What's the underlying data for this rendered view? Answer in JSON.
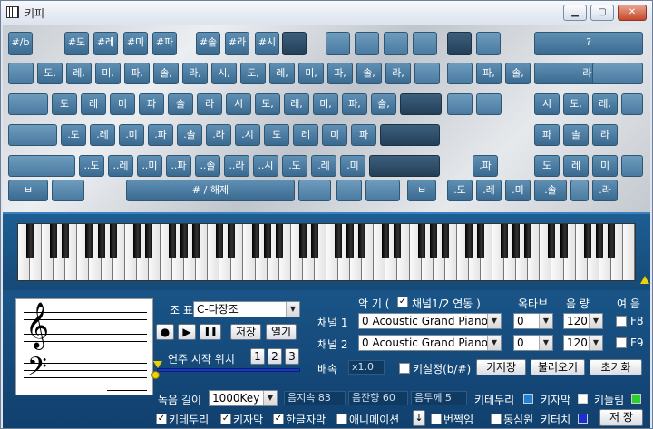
{
  "window": {
    "title": "키피",
    "min": "▁",
    "max": "▢",
    "close": "✕"
  },
  "keyboard": {
    "row1": [
      "#/b",
      "#도",
      "#레",
      "#미",
      "#파",
      "#솔",
      "#라",
      "#시",
      "",
      "",
      "",
      "",
      "",
      "",
      "",
      "?"
    ],
    "row2": [
      "",
      "도,",
      "레,",
      "미,",
      "파,",
      "솔,",
      "라,",
      "시,",
      "도,",
      "레,",
      "미,",
      "파,",
      "솔,",
      "라,",
      "",
      "",
      "파,",
      "솔,",
      "라,",
      ""
    ],
    "row3": [
      "",
      "도",
      "레",
      "미",
      "파",
      "솔",
      "라",
      "시",
      "도,",
      "레,",
      "미,",
      "파,",
      "솔,",
      "",
      "",
      "",
      "시",
      "도,",
      "레,",
      ""
    ],
    "row4": [
      "",
      ".도",
      ".레",
      ".미",
      ".파",
      ".솔",
      ".라",
      ".시",
      "도",
      "레",
      "미",
      "파",
      "",
      "파",
      "솔",
      "라"
    ],
    "row5": [
      "",
      "..도",
      "..레",
      "..미",
      "..파",
      "..솔",
      "..라",
      "..시",
      ".도",
      ".레",
      ".미",
      "",
      ".파",
      "도",
      "레",
      "미",
      ""
    ],
    "row6": [
      "ㅂ",
      "",
      "# / 해제",
      "",
      "",
      "",
      "ㅂ",
      ".도",
      ".레",
      ".미",
      ".솔",
      "",
      ".라"
    ]
  },
  "controls": {
    "key_label": "조 표",
    "key_value": "C-다장조",
    "transport": {
      "record": "●",
      "play": "▶",
      "pause": "❚❚",
      "save": "저장",
      "open": "열기"
    },
    "start_pos_label": "연주 시작 위치",
    "start_pos": [
      "1",
      "2",
      "3"
    ],
    "instrument_label": "악 기 (",
    "channel_both_label": "채널1/2 연동 )",
    "octave_label": "옥타브",
    "volume_label": "음 량",
    "sustain_label": "여 음",
    "ch1_label": "채널 1",
    "ch2_label": "채널 2",
    "ch1_instrument": "0 Acoustic Grand Piano",
    "ch2_instrument": "0 Acoustic Grand Piano",
    "ch1_octave": "0",
    "ch2_octave": "0",
    "ch1_volume": "120",
    "ch2_volume": "120",
    "f8": "F8",
    "f9": "F9",
    "speed_label": "배속",
    "speed_value": "x1.0",
    "keyset_label": "키설정(b/#)",
    "key_save": "키저장",
    "key_load": "불러오기",
    "reset": "초기화",
    "rec_length_label": "녹음 길이",
    "rec_length_value": "1000Key",
    "note_dur": "음지속 83",
    "note_vol": "음잔향 60",
    "note_thick": "음두께 5",
    "key_border_label": "키테두리",
    "key_caption_label": "키자막",
    "key_pressed_label": "키눌림",
    "chk_key_border": "키테두리",
    "chk_key_caption": "키자막",
    "chk_hangul": "한글자막",
    "chk_animation": "애니메이션",
    "chk_flash": "번쩍임",
    "chk_concentric": "동심원",
    "key_touch_label": "키터치",
    "save_button": "저 장",
    "colors": {
      "border": "#1e7fd6",
      "caption": "#ffffff",
      "pressed": "#2bd12b",
      "touch": "#1a2ed8"
    }
  }
}
